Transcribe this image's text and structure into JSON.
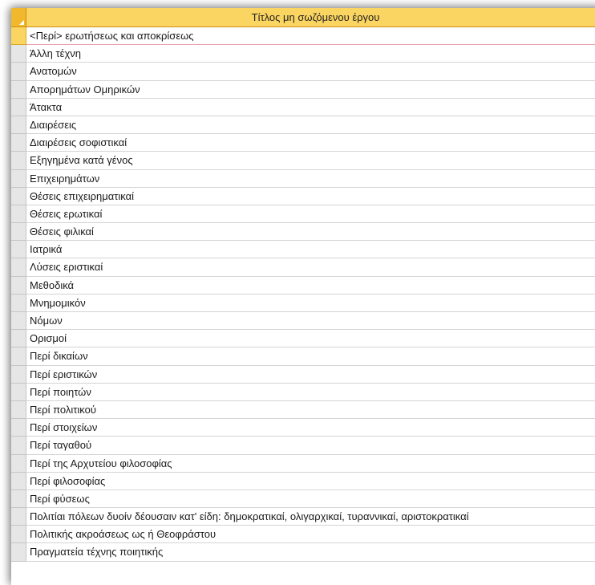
{
  "table": {
    "column_header": "Τίτλος μη σωζόμενου έργου",
    "rows": [
      "<Περί> ερωτήσεως και αποκρίσεως",
      "Άλλη τέχνη",
      "Ανατομών",
      "Απορημάτων Ομηρικών",
      "Άτακτα",
      "Διαιρέσεις",
      "Διαιρέσεις σοφιστικαί",
      "Εξηγημένα κατά γένος",
      "Επιχειρημάτων",
      "Θέσεις επιχειρηματικαί",
      "Θέσεις ερωτικαί",
      "Θέσεις φιλικαί",
      "Ιατρικά",
      "Λύσεις εριστικαί",
      "Μεθοδικά",
      "Μνημομικόν",
      "Νόμων",
      "Ορισμοί",
      "Περί δικαίων",
      "Περί εριστικών",
      "Περί ποιητών",
      "Περί πολιτικού",
      "Περί στοιχείων",
      "Περί ταγαθού",
      "Περί της Αρχυτείου φιλοσοφίας",
      "Περί φιλοσοφίας",
      "Περί φύσεως",
      "Πολιτίαι πόλεων δυοίν δέουσαιν κατ' είδη: δημοκρατικαί, ολιγαρχικαί, τυραννικαί, αριστοκρατικαί",
      "Πολιτικής ακροάσεως ως ή Θεοφράστου",
      "Πραγματεία τέχνης ποιητικής"
    ]
  },
  "icons": {
    "select_all": "select-all-triangle-icon",
    "column_dropdown": "chevron-down-icon"
  },
  "colors": {
    "header_accent": "#fbd561",
    "select_all": "#f1b82d",
    "row_selector": "#e6e6e6"
  }
}
